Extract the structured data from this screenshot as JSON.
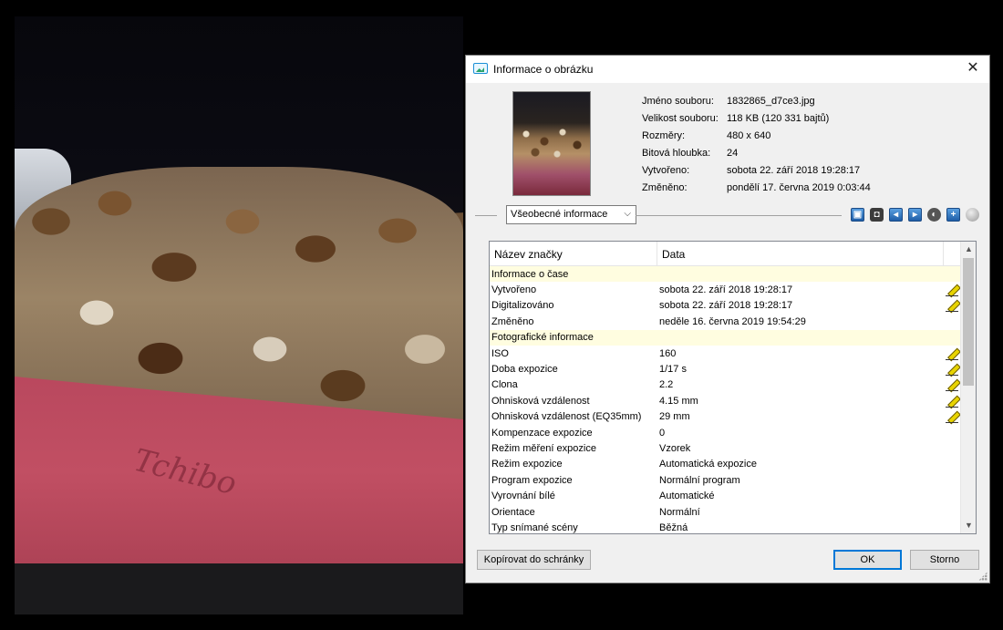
{
  "window": {
    "title": "Informace o obrázku"
  },
  "file_info": [
    {
      "label": "Jméno souboru:",
      "value": "1832865_d7ce3.jpg"
    },
    {
      "label": "Velikost souboru:",
      "value": "118 KB (120 331 bajtů)"
    },
    {
      "label": "Rozměry:",
      "value": "480 x 640"
    },
    {
      "label": "Bitová hloubka:",
      "value": "24"
    },
    {
      "label": "Vytvořeno:",
      "value": "sobota 22. září 2018 19:28:17"
    },
    {
      "label": "Změněno:",
      "value": "pondělí 17. června 2019 0:03:44"
    }
  ],
  "view_select": {
    "selected": "Všeobecné informace"
  },
  "photo": {
    "cloth_text": "Tchibo"
  },
  "table": {
    "columns": [
      "Název značky",
      "Data"
    ],
    "rows": [
      {
        "type": "section",
        "name": "Informace o čase",
        "value": "",
        "editable": false
      },
      {
        "type": "item",
        "name": "Vytvořeno",
        "value": "sobota 22. září 2018 19:28:17",
        "editable": true
      },
      {
        "type": "item",
        "name": "Digitalizováno",
        "value": "sobota 22. září 2018 19:28:17",
        "editable": true
      },
      {
        "type": "item",
        "name": "Změněno",
        "value": "neděle 16. června 2019 19:54:29",
        "editable": false
      },
      {
        "type": "section",
        "name": "Fotografické informace",
        "value": "",
        "editable": false
      },
      {
        "type": "item",
        "name": "ISO",
        "value": "160",
        "editable": true
      },
      {
        "type": "item",
        "name": "Doba expozice",
        "value": "1/17 s",
        "editable": true
      },
      {
        "type": "item",
        "name": "Clona",
        "value": "2.2",
        "editable": true
      },
      {
        "type": "item",
        "name": "Ohnisková vzdálenost",
        "value": "4.15 mm",
        "editable": true
      },
      {
        "type": "item",
        "name": "Ohnisková vzdálenost (EQ35mm)",
        "value": "29 mm",
        "editable": true
      },
      {
        "type": "item",
        "name": "Kompenzace expozice",
        "value": "0",
        "editable": false
      },
      {
        "type": "item",
        "name": "Režim měření expozice",
        "value": "Vzorek",
        "editable": false
      },
      {
        "type": "item",
        "name": "Režim expozice",
        "value": "Automatická expozice",
        "editable": false
      },
      {
        "type": "item",
        "name": "Program expozice",
        "value": "Normální program",
        "editable": false
      },
      {
        "type": "item",
        "name": "Vyrovnání bílé",
        "value": "Automatické",
        "editable": false
      },
      {
        "type": "item",
        "name": "Orientace",
        "value": "Normální",
        "editable": false
      },
      {
        "type": "item",
        "name": "Typ snímané scény",
        "value": "Běžná",
        "editable": false
      }
    ]
  },
  "buttons": {
    "copy": "Kopírovat do schránky",
    "ok": "OK",
    "cancel": "Storno"
  }
}
